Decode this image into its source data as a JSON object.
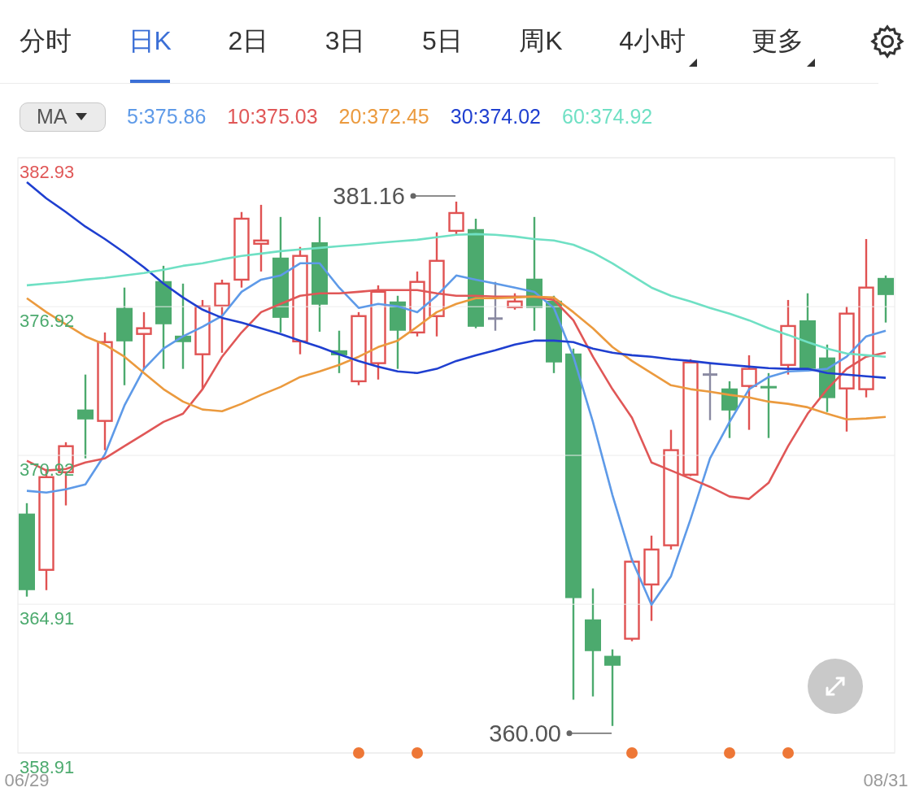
{
  "tabs": [
    {
      "label": "分时",
      "selected": false,
      "kind": "plain"
    },
    {
      "label": "日K",
      "selected": true,
      "kind": "plain"
    },
    {
      "label": "2日",
      "selected": false,
      "kind": "plain"
    },
    {
      "label": "3日",
      "selected": false,
      "kind": "plain"
    },
    {
      "label": "5日",
      "selected": false,
      "kind": "plain"
    },
    {
      "label": "周K",
      "selected": false,
      "kind": "plain"
    },
    {
      "label": "4小时",
      "selected": false,
      "kind": "dropdown"
    },
    {
      "label": "更多",
      "selected": false,
      "kind": "dropdown"
    }
  ],
  "indicator": {
    "label": "MA"
  },
  "chart": {
    "chart_data": {
      "type": "line",
      "grid": true,
      "categories": [
        "06/29",
        null,
        null,
        null,
        null,
        null,
        null,
        null,
        null,
        null,
        null,
        null,
        null,
        null,
        null,
        null,
        null,
        null,
        null,
        null,
        null,
        null,
        null,
        null,
        null,
        null,
        null,
        null,
        null,
        null,
        null,
        null,
        null,
        null,
        null,
        null,
        null,
        null,
        null,
        null,
        null,
        null,
        null,
        null,
        "08/31"
      ],
      "ylim": [
        358.91,
        382.93
      ],
      "yticks": [
        {
          "value": 382.93,
          "label": "382.93"
        },
        {
          "value": 376.92,
          "label": "376.92"
        },
        {
          "value": 370.92,
          "label": "370.92"
        },
        {
          "value": 364.91,
          "label": "364.91"
        },
        {
          "value": 358.91,
          "label": "358.91"
        }
      ],
      "series": [
        {
          "name": "5:375.86",
          "color": "#5e9ae8",
          "values": [
            369.49,
            369.42,
            369.55,
            369.75,
            370.96,
            372.93,
            374.41,
            375.23,
            375.72,
            376.11,
            376.54,
            377.52,
            378.01,
            378.18,
            378.67,
            378.67,
            377.69,
            376.87,
            377.03,
            376.93,
            376.7,
            377.36,
            378.18,
            378.01,
            377.85,
            377.69,
            377.52,
            376.87,
            374.9,
            372.27,
            369.32,
            366.7,
            364.89,
            366.04,
            368.34,
            370.8,
            372.27,
            373.59,
            374.08,
            374.31,
            374.34,
            374.41,
            374.9,
            375.72,
            375.95
          ]
        },
        {
          "name": "10:375.03",
          "color": "#e05757",
          "values": [
            370.7,
            370.31,
            370.37,
            370.63,
            370.8,
            371.29,
            371.78,
            372.27,
            372.6,
            373.59,
            374.9,
            375.88,
            376.7,
            377.03,
            377.36,
            377.46,
            377.46,
            377.52,
            377.59,
            377.59,
            377.59,
            377.46,
            377.36,
            377.36,
            377.33,
            377.33,
            377.33,
            377.19,
            376.37,
            374.9,
            373.59,
            372.44,
            370.63,
            370.31,
            369.98,
            369.65,
            369.26,
            369.16,
            369.81,
            371.29,
            372.6,
            373.59,
            374.41,
            374.9,
            375.06
          ]
        },
        {
          "name": "20:372.45",
          "color": "#eb9a3e",
          "values": [
            377.26,
            376.7,
            376.21,
            375.72,
            375.39,
            374.9,
            374.24,
            373.59,
            373.09,
            372.77,
            372.7,
            373.0,
            373.36,
            373.68,
            374.08,
            374.31,
            374.57,
            374.9,
            375.29,
            375.55,
            376.11,
            376.7,
            377.03,
            377.26,
            377.26,
            377.29,
            377.33,
            377.29,
            376.7,
            376.05,
            375.29,
            374.73,
            374.24,
            373.75,
            373.59,
            373.49,
            373.36,
            373.26,
            373.09,
            373.0,
            372.86,
            372.6,
            372.37,
            372.41,
            372.47
          ]
        },
        {
          "name": "30:374.02",
          "color": "#1f3fd0",
          "values": [
            381.95,
            381.29,
            380.74,
            380.15,
            379.65,
            379.1,
            378.51,
            377.85,
            377.29,
            376.8,
            376.47,
            376.28,
            376.05,
            375.82,
            375.55,
            375.29,
            375.0,
            374.73,
            374.5,
            374.31,
            374.24,
            374.41,
            374.73,
            374.96,
            375.16,
            375.39,
            375.55,
            375.55,
            375.49,
            375.23,
            375.06,
            374.96,
            374.9,
            374.8,
            374.73,
            374.64,
            374.57,
            374.5,
            374.44,
            374.41,
            374.41,
            374.24,
            374.18,
            374.11,
            374.05
          ]
        },
        {
          "name": "60:374.92",
          "color": "#6fe0c4",
          "values": [
            377.78,
            377.85,
            377.92,
            378.01,
            378.08,
            378.18,
            378.28,
            378.41,
            378.57,
            378.67,
            378.83,
            378.97,
            379.06,
            379.16,
            379.23,
            379.29,
            379.36,
            379.42,
            379.49,
            379.56,
            379.62,
            379.72,
            379.82,
            379.85,
            379.82,
            379.75,
            379.65,
            379.59,
            379.42,
            379.1,
            378.67,
            378.18,
            377.69,
            377.36,
            377.13,
            376.87,
            376.64,
            376.37,
            376.05,
            375.78,
            375.49,
            375.23,
            375.03,
            374.96,
            374.9
          ]
        }
      ],
      "annotations": [
        "381.16",
        "360.00"
      ]
    }
  }
}
